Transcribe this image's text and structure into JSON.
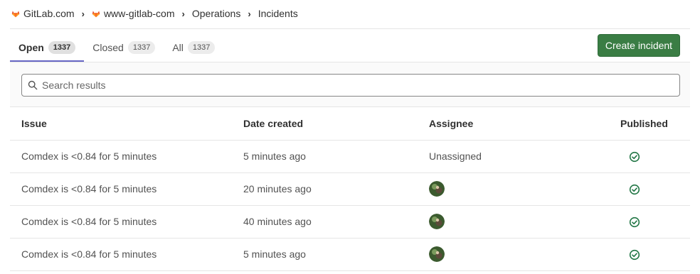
{
  "breadcrumb": {
    "items": [
      {
        "label": "GitLab.com",
        "icon": "gitlab-fox-icon"
      },
      {
        "label": "www-gitlab-com",
        "icon": "gitlab-fox-icon"
      },
      {
        "label": "Operations",
        "icon": null
      },
      {
        "label": "Incidents",
        "icon": null
      }
    ],
    "separator_icon": "chevron-right-icon"
  },
  "tabs": [
    {
      "label": "Open",
      "count": "1337",
      "active": true
    },
    {
      "label": "Closed",
      "count": "1337",
      "active": false
    },
    {
      "label": "All",
      "count": "1337",
      "active": false
    }
  ],
  "create_button": {
    "label": "Create incident",
    "color": "#3a7d44"
  },
  "search": {
    "placeholder": "Search results",
    "value": "",
    "icon": "search-icon"
  },
  "table": {
    "headers": {
      "issue": "Issue",
      "date": "Date created",
      "assignee": "Assignee",
      "published": "Published"
    },
    "rows": [
      {
        "issue": "Comdex is <0.84 for 5 minutes",
        "date": "5 minutes ago",
        "assignee": "Unassigned",
        "has_avatar": false,
        "published_icon": "check-circle-icon"
      },
      {
        "issue": "Comdex is <0.84 for 5 minutes",
        "date": "20 minutes ago",
        "assignee": "",
        "has_avatar": true,
        "published_icon": "check-circle-icon"
      },
      {
        "issue": "Comdex is <0.84 for 5 minutes",
        "date": "40 minutes ago",
        "assignee": "",
        "has_avatar": true,
        "published_icon": "check-circle-icon"
      },
      {
        "issue": "Comdex is <0.84 for 5 minutes",
        "date": "5 minutes ago",
        "assignee": "",
        "has_avatar": true,
        "published_icon": "check-circle-icon"
      }
    ]
  },
  "colors": {
    "accent_tab": "#6666c4",
    "success": "#217645",
    "gitlab_orange": "#e24329"
  }
}
